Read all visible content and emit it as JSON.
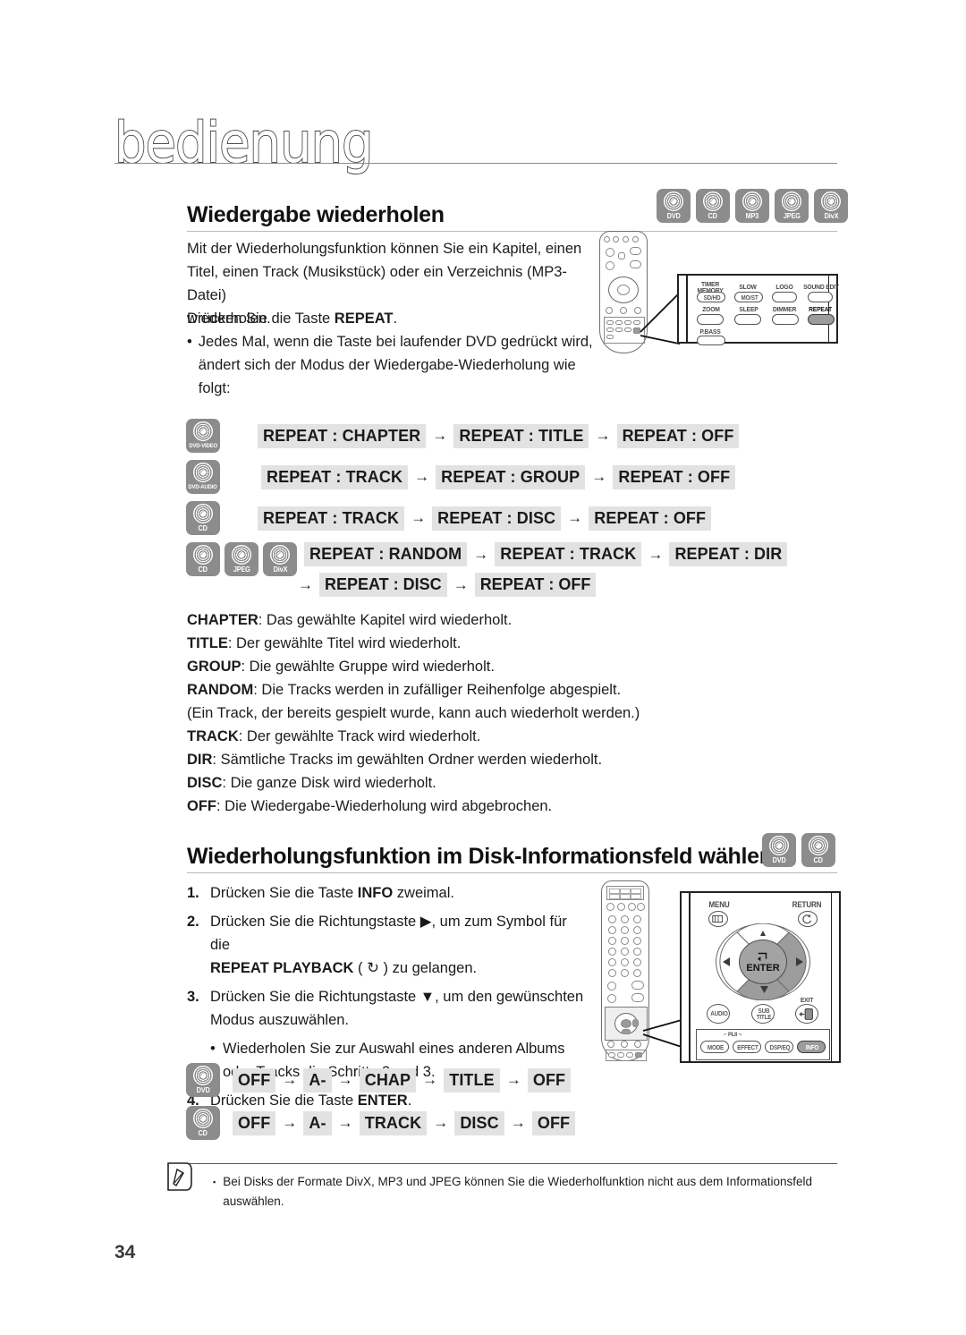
{
  "page": {
    "chapter_title": "bedienung",
    "page_number": "34"
  },
  "section1": {
    "heading": "Wiedergabe wiederholen",
    "badges": [
      {
        "label": "DVD"
      },
      {
        "label": "CD"
      },
      {
        "label": "MP3"
      },
      {
        "label": "JPEG"
      },
      {
        "label": "DivX"
      }
    ],
    "intro_l1": "Mit der Wiederholungsfunktion können Sie ein Kapitel, einen",
    "intro_l2": "Titel, einen Track (Musikstück) oder ein Verzeichnis (MP3-Datei)",
    "intro_l3": "wiederholen.",
    "press_prefix": "Drücken Sie die Taste ",
    "press_key": "REPEAT",
    "press_suffix": ".",
    "bullet_dot": "•",
    "bullet_l1": "Jedes Mal, wenn die Taste bei laufender DVD gedrückt wird,",
    "bullet_l2": "ändert sich der Modus der Wiedergabe-Wiederholung wie",
    "bullet_l3": "folgt:"
  },
  "sequences": {
    "arrow": "→",
    "rows": [
      {
        "icons": [
          {
            "label": "DVD-VIDEO"
          }
        ],
        "items": [
          "REPEAT : CHAPTER",
          "REPEAT : TITLE",
          "REPEAT : OFF"
        ]
      },
      {
        "icons": [
          {
            "label": "DVD-AUDIO"
          }
        ],
        "items": [
          "REPEAT : TRACK",
          "REPEAT : GROUP",
          "REPEAT : OFF"
        ]
      },
      {
        "icons": [
          {
            "label": "CD"
          }
        ],
        "items": [
          "REPEAT : TRACK",
          "REPEAT : DISC",
          "REPEAT : OFF"
        ]
      },
      {
        "icons": [
          {
            "label": "CD"
          },
          {
            "label": "JPEG"
          },
          {
            "label": "DivX"
          }
        ],
        "items": [
          "REPEAT : RANDOM",
          "REPEAT : TRACK",
          "REPEAT : DIR"
        ],
        "items_line2": [
          "REPEAT : DISC",
          "REPEAT : OFF"
        ]
      }
    ]
  },
  "definitions": [
    {
      "term": "CHAPTER",
      "desc": ": Das gewählte Kapitel wird wiederholt."
    },
    {
      "term": "TITLE",
      "desc": ": Der gewählte Titel wird wiederholt."
    },
    {
      "term": "GROUP",
      "desc": ": Die gewählte Gruppe wird wiederholt."
    },
    {
      "term": "RANDOM",
      "desc": ": Die Tracks werden in zufälliger Reihenfolge abgespielt."
    },
    {
      "term": "",
      "desc": "(Ein Track, der bereits gespielt wurde, kann auch wiederholt werden.)"
    },
    {
      "term": "TRACK",
      "desc": ": Der gewählte Track wird wiederholt."
    },
    {
      "term": "DIR",
      "desc": ": Sämtliche Tracks im gewählten Ordner werden wiederholt."
    },
    {
      "term": "DISC",
      "desc": ": Die ganze Disk wird wiederholt."
    },
    {
      "term": "OFF",
      "desc": ": Die Wiedergabe-Wiederholung wird abgebrochen."
    }
  ],
  "section2": {
    "heading": "Wiederholungsfunktion im Disk-Informationsfeld wählen",
    "badges": [
      {
        "label": "DVD"
      },
      {
        "label": "CD"
      }
    ],
    "steps": [
      {
        "n": "1.",
        "lines": [
          {
            "pre": "Drücken Sie die Taste ",
            "bold": "INFO",
            "post": " zweimal."
          }
        ]
      },
      {
        "n": "2.",
        "lines": [
          {
            "pre": "Drücken Sie die Richtungstaste ▶, um zum Symbol für die",
            "bold": "",
            "post": ""
          },
          {
            "pre": "",
            "bold": "REPEAT PLAYBACK",
            "post": " ( ↻ ) zu gelangen."
          }
        ]
      },
      {
        "n": "3.",
        "lines": [
          {
            "pre": "Drücken Sie die Richtungstaste ▼, um den gewünschten",
            "bold": "",
            "post": ""
          },
          {
            "pre": "Modus auszuwählen.",
            "bold": "",
            "post": ""
          }
        ],
        "sub_bullet_dot": "•",
        "sub_lines": [
          "Wiederholen Sie zur Auswahl eines anderen Albums",
          "oder Tracks die Schritte 2 und 3."
        ]
      },
      {
        "n": "4.",
        "lines": [
          {
            "pre": "Drücken Sie die Taste ",
            "bold": "ENTER",
            "post": "."
          }
        ]
      }
    ]
  },
  "sequences2": {
    "arrow": "→",
    "rows": [
      {
        "icons": [
          {
            "label": "DVD"
          }
        ],
        "items": [
          "OFF",
          "A-",
          "CHAP",
          "TITLE",
          "OFF"
        ]
      },
      {
        "icons": [
          {
            "label": "CD"
          }
        ],
        "items": [
          "OFF",
          "A-",
          "TRACK",
          "DISC",
          "OFF"
        ]
      }
    ]
  },
  "note": {
    "marker": "▪",
    "line1": "Bei Disks der Formate DivX, MP3 und JPEG können Sie die Wiederholfunktion nicht aus dem Informationsfeld",
    "line2": "auswählen."
  },
  "remote_top": {
    "callout_labels": {
      "timer_memory_l1": "TIMER",
      "timer_memory_l2": "MEMORY",
      "slow": "SLOW",
      "logo": "LOGO",
      "sound_edit": "SOUND EDIT",
      "sd_hd": "SD/HD",
      "mo_st": "MO/ST",
      "zoom": "ZOOM",
      "sleep": "SLEEP",
      "dimmer": "DIMMER",
      "repeat": "REPEAT",
      "p_bass": "P.BASS"
    }
  },
  "remote_bottom": {
    "callout_labels": {
      "menu": "MENU",
      "return": "RETURN",
      "enter": "ENTER",
      "audio": "AUDIO",
      "sub": "SUB",
      "title": "TITLE",
      "exit": "EXIT",
      "dolby": "PLII",
      "mode": "MODE",
      "effect": "EFFECT",
      "dsp_eq": "DSP/EQ",
      "info": "INFO"
    }
  },
  "colors": {
    "badge_gray": "#8c8c8c",
    "chip_gray": "#e2e2e2",
    "highlight_gray": "#9c9c9c",
    "rule_gray": "#b9b9b9"
  }
}
